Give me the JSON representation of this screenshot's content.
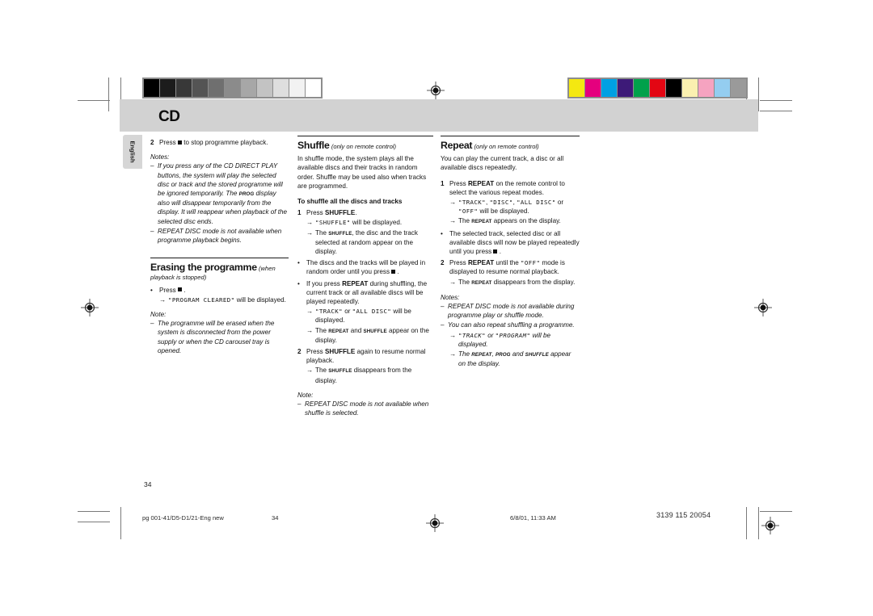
{
  "page": {
    "chapter_title": "CD",
    "language_tab": "English",
    "folio": "34"
  },
  "calibration": {
    "grayscale_label": "grayscale-wedge",
    "gray_steps": [
      "#000000",
      "#1c1c1c",
      "#383838",
      "#545454",
      "#6f6f6f",
      "#8b8b8b",
      "#a7a7a7",
      "#c3c3c3",
      "#dedede",
      "#f2f2f2",
      "#ffffff"
    ],
    "color_label": "color-control-bar",
    "color_steps": [
      "#f4e811",
      "#e5007e",
      "#00a0e3",
      "#3d1a78",
      "#00a14b",
      "#e30613",
      "#000000",
      "#faf0b0",
      "#f5a3c0",
      "#94cdf0",
      "#9a9a9a"
    ]
  },
  "column_left": {
    "step2": {
      "num": "2",
      "pre": "Press",
      "icon": "stop-square",
      "post": "to stop programme playback."
    },
    "notes_label": "Notes:",
    "note1_a": "If you press any of the CD DIRECT PLAY buttons, the system will play the selected disc or track and the stored programme will be ignored temporarily. The",
    "note1_indicator": "PROG",
    "note1_b": "display also will disappear temporarily from the display. It will reappear when playback of the selected disc ends.",
    "note2": "REPEAT DISC mode is not available when programme playback begins.",
    "section": {
      "heading": "Erasing the programme",
      "subheading": "(when playback is stopped)",
      "bullet_pre": "Press",
      "bullet_icon": "stop-square",
      "bullet_post": ".",
      "result_lcd": "\"PROGRAM CLEARED\"",
      "result_tail": "will be displayed.",
      "note_label": "Note:",
      "note": "The programme will be erased when the system is disconnected from the power supply or when the CD carousel tray is opened."
    }
  },
  "column_middle": {
    "heading": "Shuffle",
    "subheading": "(only on remote control)",
    "intro": "In shuffle mode, the system plays all the available discs and their tracks in random order. Shuffle may be used also when tracks are programmed.",
    "subhead": "To shuffle all the discs and tracks",
    "step1": {
      "num": "1",
      "pre": "Press",
      "btn": "SHUFFLE",
      "post": "."
    },
    "step1_r1_lcd": "\"SHUFFLE\"",
    "step1_r1_tail": "will be displayed.",
    "step1_r2_pre": "The",
    "step1_r2_indicator": "SHUFFLE",
    "step1_r2_post": ", the disc and the track selected at random appear on the display.",
    "bullet1_pre": "The discs and the tracks will be played in random order until you press",
    "bullet1_icon": "stop-square",
    "bullet1_post": ".",
    "bullet2_pre": "If you press",
    "bullet2_btn": "REPEAT",
    "bullet2_post": "during shuffling, the current track or all available discs will be played repeatedly.",
    "bullet2_r1_lcd_a": "\"TRACK\"",
    "bullet2_r1_mid": "or",
    "bullet2_r1_lcd_b": "\"ALL DISC\"",
    "bullet2_r1_tail": "will be displayed.",
    "bullet2_r2_pre": "The",
    "bullet2_r2_ind_a": "REPEAT",
    "bullet2_r2_mid": "and",
    "bullet2_r2_ind_b": "SHUFFLE",
    "bullet2_r2_post": "appear on the display.",
    "step2": {
      "num": "2",
      "pre": "Press",
      "btn": "SHUFFLE",
      "post": "again to resume normal playback."
    },
    "step2_r1_pre": "The",
    "step2_r1_indicator": "SHUFFLE",
    "step2_r1_post": "disappears from the display.",
    "note_label": "Note:",
    "note": "REPEAT DISC mode is not available when shuffle is selected."
  },
  "column_right": {
    "heading": "Repeat",
    "subheading": "(only on remote control)",
    "intro": "You can play the current track, a disc or all available discs repeatedly.",
    "step1": {
      "num": "1",
      "pre": "Press",
      "btn": "REPEAT",
      "post": "on the remote control to select the various repeat modes."
    },
    "step1_r1_lcd_a": "\"TRACK\"",
    "step1_r1_c1": ",",
    "step1_r1_lcd_b": "\"DISC\"",
    "step1_r1_c2": ",",
    "step1_r1_lcd_c": "\"ALL DISC\"",
    "step1_r1_or": "or",
    "step1_r1_lcd_d": "\"OFF\"",
    "step1_r1_tail": "will be displayed.",
    "step1_r2_pre": "The",
    "step1_r2_indicator": "REPEAT",
    "step1_r2_post": "appears on the display.",
    "bullet1_pre": "The selected track, selected disc or all available discs will now be played repeatedly until you press",
    "bullet1_icon": "stop-square",
    "bullet1_post": ".",
    "step2": {
      "num": "2",
      "pre": "Press",
      "btn": "REPEAT",
      "mid": "until the",
      "lcd": "\"OFF\"",
      "post": "mode is displayed to resume normal playback."
    },
    "step2_r1_pre": "The",
    "step2_r1_indicator": "REPEAT",
    "step2_r1_post": "disappears from the display.",
    "notes_label": "Notes:",
    "note1": "REPEAT DISC mode is not available during programme play or shuffle mode.",
    "note2": "You can also repeat shuffling a programme.",
    "note2_r1_lcd_a": "\"TRACK\"",
    "note2_r1_or": "or",
    "note2_r1_lcd_b": "\"PROGRAM\"",
    "note2_r1_tail": "will be displayed.",
    "note2_r2_pre": "The",
    "note2_r2_ind_a": "REPEAT",
    "note2_r2_c": ",",
    "note2_r2_ind_b": "PROG",
    "note2_r2_and": "and",
    "note2_r2_ind_c": "SHUFFLE",
    "note2_r2_post": "appear on the display."
  },
  "footer": {
    "file_slug": "pg 001-41/D5-D1/21-Eng new",
    "page_number": "34",
    "timestamp": "6/8/01, 11:33 AM",
    "document_code": "3139 115 20054"
  }
}
